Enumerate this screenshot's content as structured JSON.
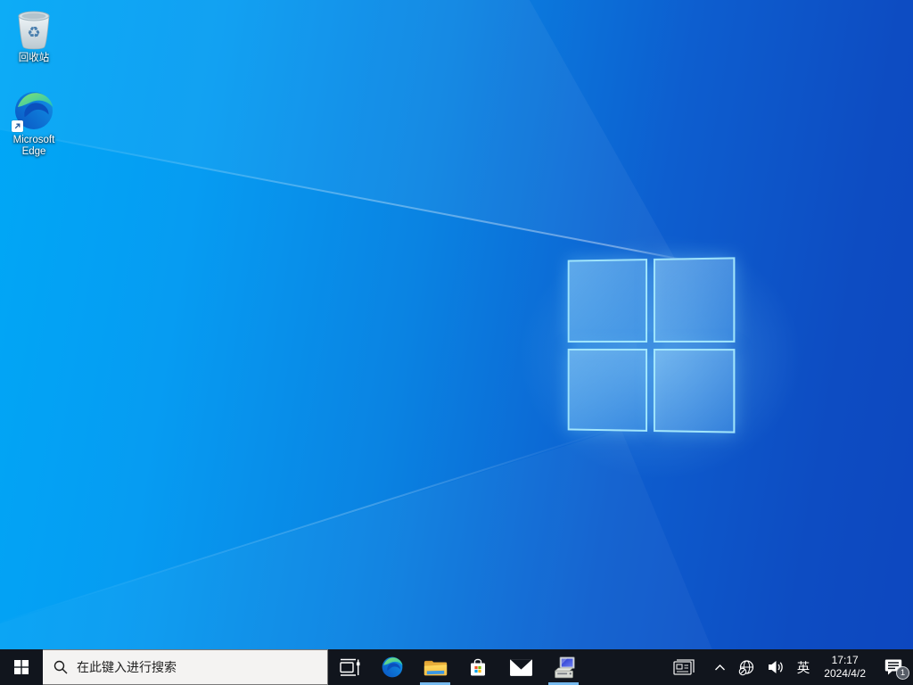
{
  "desktop": {
    "icons": [
      {
        "name": "recycle-bin",
        "label": "回收站"
      },
      {
        "name": "microsoft-edge",
        "label": "Microsoft Edge",
        "lines": [
          "Microsoft",
          "Edge"
        ]
      }
    ]
  },
  "taskbar": {
    "search": {
      "placeholder": "在此键入进行搜索"
    },
    "apps": [
      "start",
      "task-view",
      "edge",
      "file-explorer",
      "store",
      "mail",
      "installer"
    ],
    "running_apps_with_indicator": [
      "file-explorer",
      "installer"
    ],
    "tray": {
      "ime": "英",
      "time": "17:17",
      "date": "2024/4/2",
      "notification_badge": "1",
      "icons": [
        "news-icon",
        "chevron-up-icon",
        "globe-offline-icon",
        "speaker-icon",
        "action-center-icon"
      ]
    }
  },
  "icons": {
    "start": "windows-logo",
    "search": "magnifier",
    "task-view": "timeline-panel",
    "edge": "edge-swirl",
    "file-explorer": "yellow-folder",
    "store": "shopping-bag-ms-logo",
    "mail": "white-envelope",
    "installer": "computer-setup",
    "news": "newspaper-outline",
    "network": "globe-with-no-internet",
    "volume": "speaker-with-waves",
    "action-center": "message-bubble"
  },
  "colors": {
    "taskbar_bg": "#11151d",
    "search_bg": "#f4f3f2",
    "active_underline": "#76b9ed",
    "wallpaper_left": "#00a8f6",
    "wallpaper_right": "#0d47bf",
    "logo_pane_border": "#aff2ff",
    "store_red": "#f25022",
    "store_green": "#7fba00",
    "store_blue": "#00a4ef",
    "store_yellow": "#ffb900"
  }
}
